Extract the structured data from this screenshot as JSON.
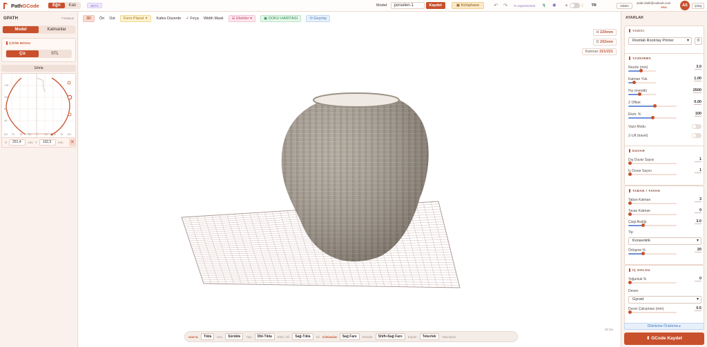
{
  "app": {
    "name_a": "Path",
    "name_b": "GCode",
    "mode_tabs": [
      "Eğri",
      "Katı"
    ],
    "beta": "BETA"
  },
  "topbar": {
    "model_label": "Model:",
    "model_name": "porselen-1",
    "save": "Kaydet",
    "library": "Kütüphane",
    "experimental": "% experimental",
    "lang": "TR",
    "email": "aslan.fatih@outlook.com",
    "plan": "PRO",
    "avatar": "AS",
    "admin": "Admin",
    "logout": "Çıkış"
  },
  "left": {
    "title": "GPATH",
    "guide": "? Kılavuz",
    "tabs": [
      "Model",
      "Katmanlar"
    ],
    "draw_title": "ÇİZİM MODU",
    "draw_tabs": [
      "Çiz",
      "STL"
    ],
    "reset": "Sıfırla",
    "y_ticks": [
      "175",
      "131",
      "88",
      "44"
    ],
    "x_ticks": [
      "100",
      "75",
      "50",
      "25",
      "0",
      "25",
      "50",
      "75",
      "100"
    ],
    "x_label": "X",
    "x_value": "201,4",
    "y_label": "Y",
    "y_value": "132,5",
    "unit": "mm"
  },
  "viewport": {
    "toolbar": [
      "3D",
      "Ön",
      "Üst",
      "Form Planol ✦",
      "Kafes Düzenle",
      "✓ Fırça",
      "Width Mask",
      "☰ Efektler ▾",
      "▣ DOKU HARİTASI",
      "⟲ Geçmiş"
    ],
    "h": "H",
    "h_val": "220mm",
    "d": "D",
    "d_val": "202mm",
    "layer": "Katman",
    "layer_val": "221/221",
    "fps": "56 fps"
  },
  "hints": [
    {
      "g": "NOKTA"
    },
    {
      "k": "Tıkla",
      "d": "Seç"
    },
    {
      "k": "Sürükle",
      "d": "Taşı"
    },
    {
      "k": "Dbl-Tıkla",
      "d": "Ekle / Sil"
    },
    {
      "k": "Sağ-Tıkla",
      "d": "Sil"
    },
    {
      "g": "GÖRÜNÜM"
    },
    {
      "k": "Sağ Fare",
      "d": "Döndür"
    },
    {
      "k": "Shift+Sağ Fare",
      "d": "Kaydır"
    },
    {
      "k": "Tekerlek",
      "d": "Yakınlaştır"
    }
  ],
  "right": {
    "title": "AYARLAR",
    "printer_title": "YAZICI",
    "printer": "Rootlab Rootclay Printer",
    "print_title": "YAZDIRMA",
    "nozzle": "Nozzle (mm)",
    "nozzle_v": "3.0",
    "layer_h": "Katman Yük.",
    "layer_v": "1.00",
    "speed": "Hız (mm/dk)",
    "speed_v": "2500",
    "zoff": "Z Offset",
    "zoff_v": "0.00",
    "extr": "Ekstr. %",
    "extr_v": "100",
    "vase": "Vazo Modu",
    "zlift": "Z-Lift (travel)",
    "wall_title": "DUVAR",
    "outer": "Dış Duvar Sayısı",
    "outer_v": "1",
    "inner": "İç Duvar Sayısı",
    "inner_v": "1",
    "base_title": "TABAN / TAVAN",
    "base": "Taban Katman",
    "base_v": "3",
    "top": "Tavan Katman",
    "top_v": "0",
    "spacing": "Çizgi Aralığı",
    "spacing_v": "3.0",
    "type": "Tip",
    "type_sel": "Konsentrik",
    "overlap": "Örtüşme %",
    "overlap_v": "20",
    "infill_title": "İÇ DOLGU",
    "density": "Yoğunluk %",
    "density_v": "0",
    "pattern": "Desen",
    "pattern_sel": "Gyroid",
    "dist": "Duvar Çakışması (mm)",
    "dist_v": "0.5",
    "preview": "Dilimleme Önizleme ▸",
    "gcode": "⬇ GCode Kaydet"
  },
  "levels": {
    "nozzle": 0.45,
    "layer": 0.2,
    "speed": 0.4,
    "zoff": 0.55,
    "extr": 0.5,
    "outer": 0.03,
    "inner": 0.03,
    "base": 0.03,
    "top": 0.03,
    "spacing": 0.3,
    "overlap": 0.3,
    "density": 0.03,
    "dist": 0.03
  },
  "colors": {
    "accent": "#c8502d",
    "vase": "#a59c8e",
    "grid": "#c2a6a1"
  }
}
